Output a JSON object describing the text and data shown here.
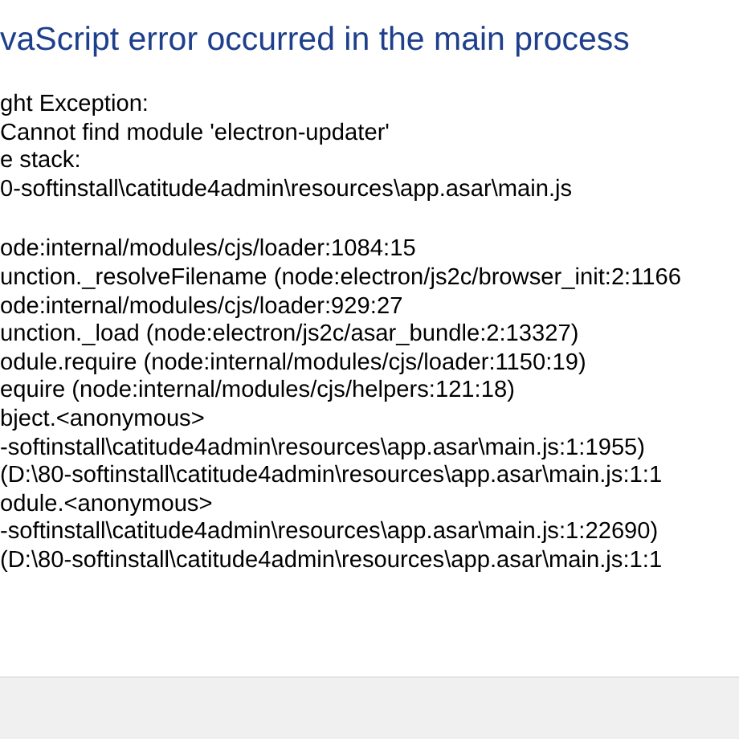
{
  "dialog": {
    "title": "vaScript error occurred in the main process",
    "message_lines": [
      "ght Exception:",
      "Cannot find module 'electron-updater'",
      "e stack:",
      "0-softinstall\\catitude4admin\\resources\\app.asar\\main.js"
    ],
    "stack_lines": [
      "ode:internal/modules/cjs/loader:1084:15",
      "unction._resolveFilename (node:electron/js2c/browser_init:2:1166",
      "ode:internal/modules/cjs/loader:929:27",
      "unction._load (node:electron/js2c/asar_bundle:2:13327)",
      "odule.require (node:internal/modules/cjs/loader:1150:19)",
      "equire (node:internal/modules/cjs/helpers:121:18)",
      "bject.<anonymous>",
      "-softinstall\\catitude4admin\\resources\\app.asar\\main.js:1:1955)",
      "(D:\\80-softinstall\\catitude4admin\\resources\\app.asar\\main.js:1:1",
      "odule.<anonymous>",
      "-softinstall\\catitude4admin\\resources\\app.asar\\main.js:1:22690)",
      "(D:\\80-softinstall\\catitude4admin\\resources\\app.asar\\main.js:1:1"
    ]
  }
}
